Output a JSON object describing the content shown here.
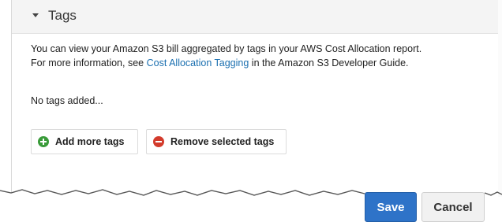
{
  "tags_section": {
    "title": "Tags",
    "info_line1": "You can view your Amazon S3 bill aggregated by tags in your AWS Cost Allocation report.",
    "info_prefix": "For more information, see ",
    "info_link": "Cost Allocation Tagging",
    "info_suffix": " in the Amazon S3 Developer Guide.",
    "empty_text": "No tags added...",
    "add_label": "Add more tags",
    "remove_label": "Remove selected tags"
  },
  "footer": {
    "save_label": "Save",
    "cancel_label": "Cancel"
  },
  "icons": {
    "add": "plus-circle-icon",
    "remove": "minus-circle-icon",
    "caret": "caret-down-icon"
  },
  "colors": {
    "primary": "#2e73c8",
    "link": "#1a6fb0",
    "add_icon": "#3a9b3a",
    "remove_icon": "#d33b2c"
  }
}
